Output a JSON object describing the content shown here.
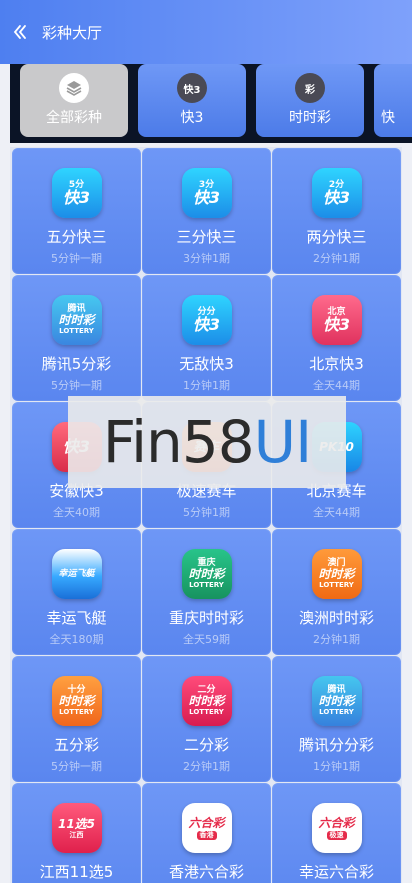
{
  "header": {
    "title": "彩种大厅"
  },
  "tabs": [
    {
      "label": "全部彩种",
      "icon": "layers-icon",
      "active": true
    },
    {
      "label": "快3",
      "icon": "k3-badge-icon",
      "active": false
    },
    {
      "label": "时时彩",
      "icon": "ssc-badge-icon",
      "active": false
    },
    {
      "label": "快",
      "icon": "",
      "active": false
    }
  ],
  "games": [
    {
      "name": "五分快三",
      "desc": "5分钟一期",
      "icon_top": "5分",
      "icon_main": "快3"
    },
    {
      "name": "三分快三",
      "desc": "3分钟1期",
      "icon_top": "3分",
      "icon_main": "快3"
    },
    {
      "name": "两分快三",
      "desc": "2分钟1期",
      "icon_top": "2分",
      "icon_main": "快3"
    },
    {
      "name": "腾讯5分彩",
      "desc": "5分钟一期",
      "icon_top": "腾讯",
      "icon_main": "时时彩",
      "icon_sub": "LOTTERY"
    },
    {
      "name": "无敌快3",
      "desc": "1分钟1期",
      "icon_top": "分分",
      "icon_main": "快3"
    },
    {
      "name": "北京快3",
      "desc": "全天44期",
      "icon_top": "北京",
      "icon_main": "快3"
    },
    {
      "name": "安徽快3",
      "desc": "全天40期",
      "icon_top": "",
      "icon_main": "快3"
    },
    {
      "name": "极速赛车",
      "desc": "5分钟1期",
      "icon_top": "",
      "icon_main": "赛车"
    },
    {
      "name": "北京赛车",
      "desc": "全天44期",
      "icon_top": "",
      "icon_main": "PK10"
    },
    {
      "name": "幸运飞艇",
      "desc": "全天180期",
      "icon_top": "",
      "icon_main": "幸运飞艇"
    },
    {
      "name": "重庆时时彩",
      "desc": "全天59期",
      "icon_top": "重庆",
      "icon_main": "时时彩",
      "icon_sub": "LOTTERY"
    },
    {
      "name": "澳洲时时彩",
      "desc": "2分钟1期",
      "icon_top": "澳门",
      "icon_main": "时时彩",
      "icon_sub": "LOTTERY"
    },
    {
      "name": "五分彩",
      "desc": "5分钟一期",
      "icon_top": "十分",
      "icon_main": "时时彩",
      "icon_sub": "LOTTERY"
    },
    {
      "name": "二分彩",
      "desc": "2分钟1期",
      "icon_top": "二分",
      "icon_main": "时时彩",
      "icon_sub": "LOTTERY"
    },
    {
      "name": "腾讯分分彩",
      "desc": "1分钟1期",
      "icon_top": "腾讯",
      "icon_main": "时时彩",
      "icon_sub": "LOTTERY"
    },
    {
      "name": "江西11选5",
      "desc": "",
      "icon_top": "",
      "icon_main": "11选5",
      "icon_sub": "江西"
    },
    {
      "name": "香港六合彩",
      "desc": "",
      "icon_top": "",
      "icon_main": "六合彩",
      "icon_sub": "香港"
    },
    {
      "name": "幸运六合彩",
      "desc": "",
      "icon_top": "",
      "icon_main": "六合彩",
      "icon_sub": "极速"
    }
  ],
  "watermark": {
    "text_a": "Fin58",
    "text_b": "UI"
  }
}
